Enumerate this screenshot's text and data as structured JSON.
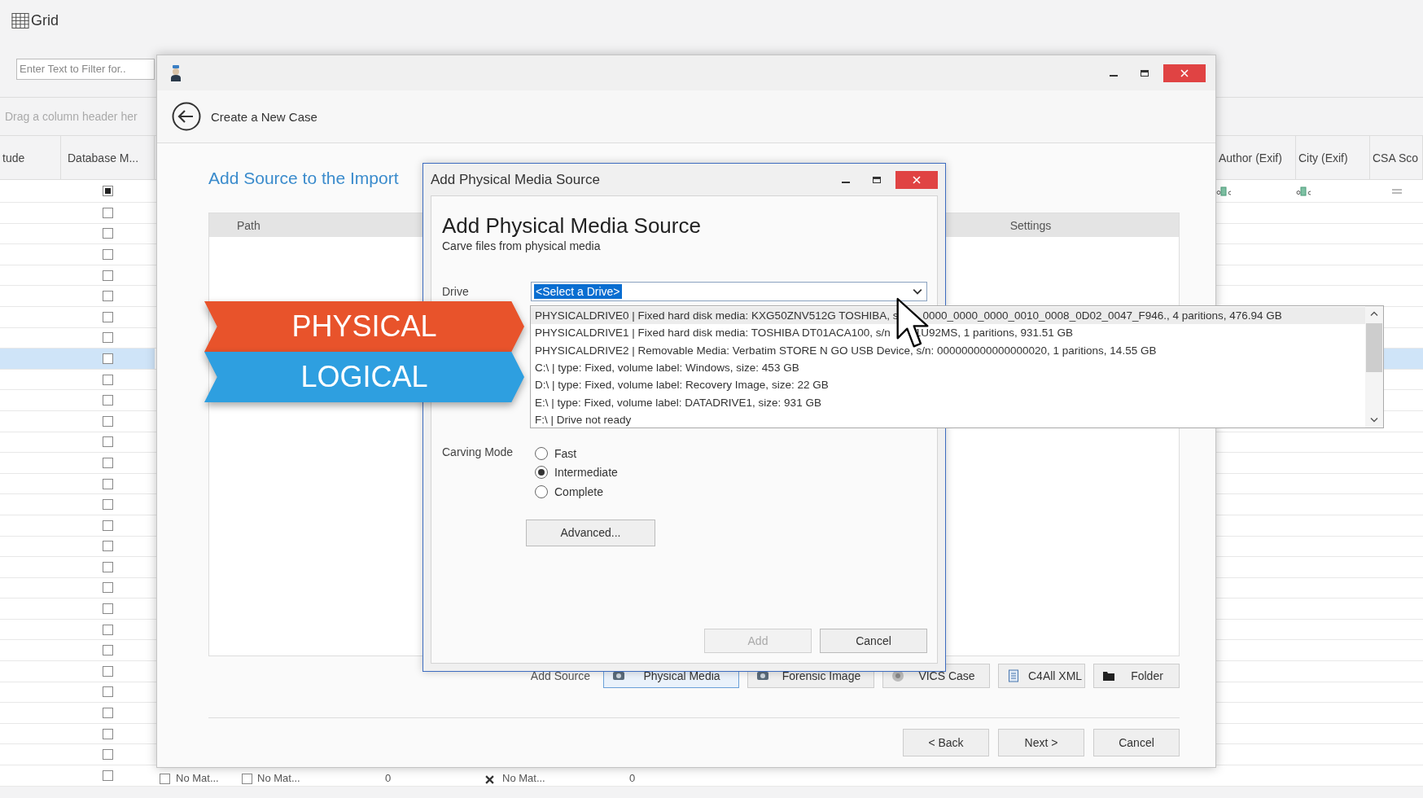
{
  "app": {
    "title": "Grid",
    "filter": {
      "placeholder": "Enter Text to Filter for.."
    },
    "group_hint": "Drag a column header her",
    "columns_left": [
      "tude",
      "Database M..."
    ],
    "columns_right": [
      "Author (Exif)",
      "City (Exif)",
      "CSA Sco"
    ],
    "filter_row": {
      "checked": true
    },
    "rows": [
      {
        "checked": false,
        "selected": false
      },
      {
        "checked": false,
        "selected": false
      },
      {
        "checked": false,
        "selected": false
      },
      {
        "checked": false,
        "selected": false
      },
      {
        "checked": false,
        "selected": false
      },
      {
        "checked": false,
        "selected": false
      },
      {
        "checked": false,
        "selected": false
      },
      {
        "checked": false,
        "selected": true
      },
      {
        "checked": false,
        "selected": false
      },
      {
        "checked": false,
        "selected": false
      },
      {
        "checked": false,
        "selected": false
      },
      {
        "checked": false,
        "selected": false
      },
      {
        "checked": false,
        "selected": false
      },
      {
        "checked": false,
        "selected": false
      },
      {
        "checked": false,
        "selected": false
      },
      {
        "checked": false,
        "selected": false
      },
      {
        "checked": false,
        "selected": false
      },
      {
        "checked": false,
        "selected": false
      },
      {
        "checked": false,
        "selected": false
      },
      {
        "checked": false,
        "selected": false
      },
      {
        "checked": false,
        "selected": false
      },
      {
        "checked": false,
        "selected": false
      },
      {
        "checked": false,
        "selected": false
      },
      {
        "checked": false,
        "selected": false
      },
      {
        "checked": false,
        "selected": false
      },
      {
        "checked": false,
        "selected": false
      },
      {
        "checked": false,
        "selected": false
      },
      {
        "checked": false,
        "selected": false,
        "cells": [
          {
            "kind": "check",
            "checked": false
          },
          {
            "kind": "text",
            "text": "No Mat..."
          },
          {
            "kind": "check",
            "checked": false
          },
          {
            "kind": "text",
            "text": "No Mat..."
          },
          {
            "kind": "text",
            "text": "0"
          },
          {
            "kind": "cross"
          },
          {
            "kind": "text",
            "text": "No Mat..."
          },
          {
            "kind": "text",
            "text": "0"
          }
        ]
      }
    ]
  },
  "wizard": {
    "title": "Create a New Case",
    "heading": "Add Source to the Import",
    "table_columns": [
      "Path",
      "Settings"
    ],
    "add_source_label": "Add Source",
    "source_buttons": [
      {
        "label": "Physical Media",
        "selected": true
      },
      {
        "label": "Forensic Image",
        "selected": false
      },
      {
        "label": "VICS Case",
        "selected": false
      },
      {
        "label": "C4All XML",
        "selected": false
      },
      {
        "label": "Folder",
        "selected": false
      }
    ],
    "footer_buttons": [
      "< Back",
      "Next >",
      "Cancel"
    ]
  },
  "dialog": {
    "title": "Add Physical Media Source",
    "heading": "Add Physical Media Source",
    "subtitle": "Carve files from physical media",
    "drive_label": "Drive",
    "drive_value": "<Select a Drive>",
    "drive_options": [
      {
        "parts": [
          "PHYSICALDRIVE0 | Fixed hard disk media: KXG50ZNV512G TOSHIBA, s",
          "0000_0000_0000_0010_0008_0D02_0047_F946., 4 paritions, 476.94 GB"
        ],
        "selected": true
      },
      {
        "parts": [
          "PHYSICALDRIVE1 | Fixed hard disk media: TOSHIBA DT01ACA100, s/n",
          "1U92MS, 1 paritions, 931.51 GB"
        ],
        "selected": false
      },
      {
        "parts": [
          "PHYSICALDRIVE2 | Removable Media: Verbatim STORE N GO USB Device, s/n: 000000000000000020, 1 paritions, 14.55 GB"
        ],
        "selected": false
      },
      {
        "parts": [
          "C:\\ | type: Fixed, volume label: Windows, size: 453 GB"
        ],
        "selected": false
      },
      {
        "parts": [
          "D:\\ | type: Fixed, volume label: Recovery Image, size: 22 GB"
        ],
        "selected": false
      },
      {
        "parts": [
          "E:\\ | type: Fixed, volume label: DATADRIVE1, size: 931 GB"
        ],
        "selected": false
      },
      {
        "parts": [
          "F:\\ | Drive not ready"
        ],
        "selected": false
      }
    ],
    "carving_label": "Carving Mode",
    "modes": [
      {
        "label": "Fast",
        "selected": false
      },
      {
        "label": "Intermediate",
        "selected": true
      },
      {
        "label": "Complete",
        "selected": false
      }
    ],
    "advanced": "Advanced...",
    "buttons": [
      {
        "label": "Add",
        "disabled": true
      },
      {
        "label": "Cancel",
        "disabled": false
      }
    ]
  },
  "banners": [
    {
      "label": "PHYSICAL",
      "color": "#e8532b"
    },
    {
      "label": "LOGICAL",
      "color": "#2e9fe0"
    }
  ]
}
